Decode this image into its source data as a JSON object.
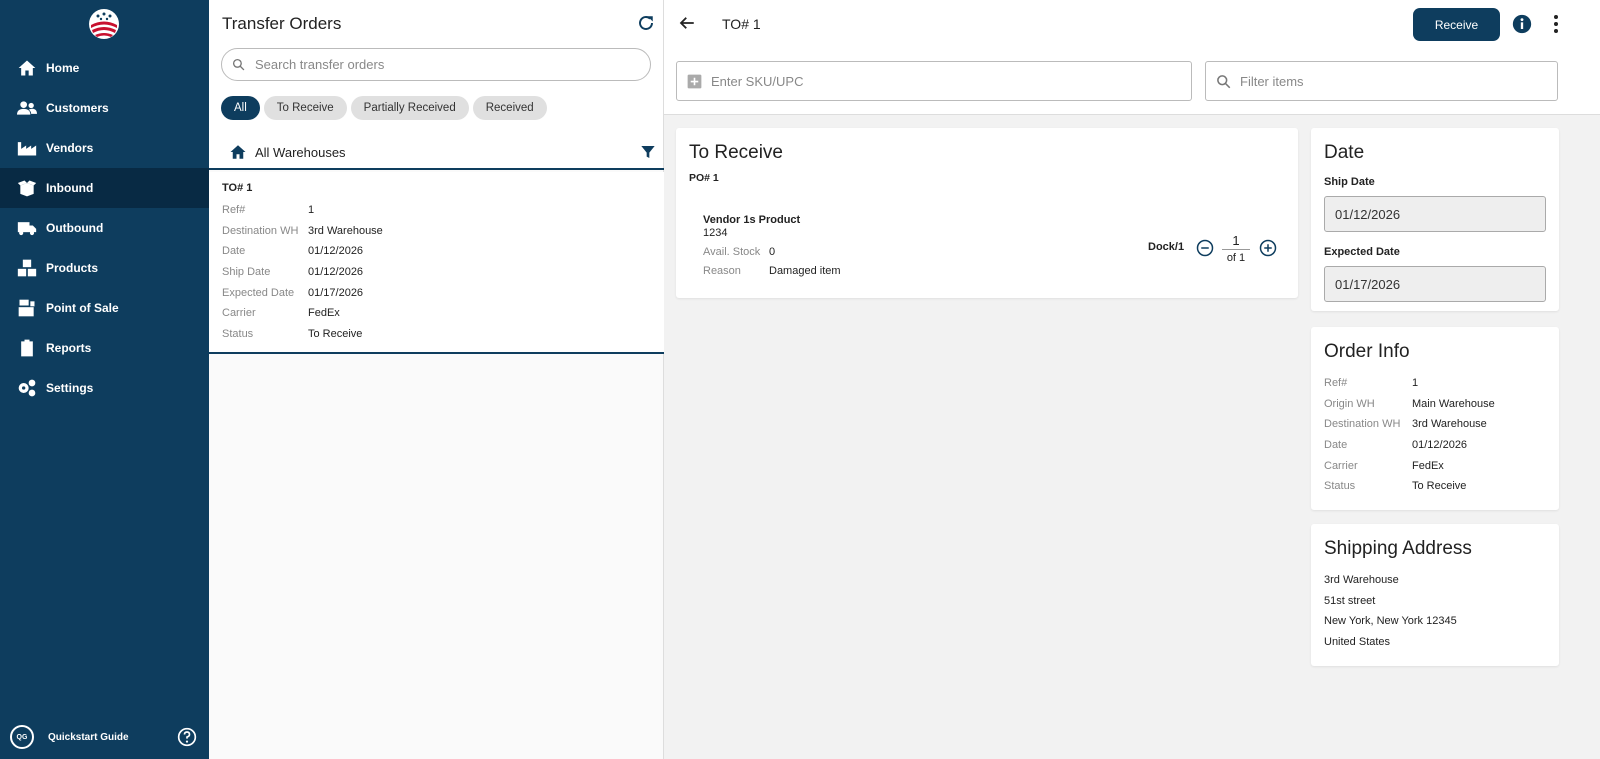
{
  "sidebar": {
    "items": [
      {
        "label": "Home",
        "icon": "home-icon"
      },
      {
        "label": "Customers",
        "icon": "users-icon"
      },
      {
        "label": "Vendors",
        "icon": "factory-icon"
      },
      {
        "label": "Inbound",
        "icon": "box-open-icon",
        "active": true
      },
      {
        "label": "Outbound",
        "icon": "truck-icon"
      },
      {
        "label": "Products",
        "icon": "boxes-icon"
      },
      {
        "label": "Point of Sale",
        "icon": "pos-icon"
      },
      {
        "label": "Reports",
        "icon": "clipboard-icon"
      },
      {
        "label": "Settings",
        "icon": "gears-icon"
      }
    ],
    "footer": {
      "badge": "QG",
      "label": "Quickstart Guide"
    }
  },
  "list": {
    "title": "Transfer Orders",
    "search_placeholder": "Search transfer orders",
    "chips": [
      "All",
      "To Receive",
      "Partially Received",
      "Received"
    ],
    "warehouse": "All Warehouses",
    "order": {
      "title": "TO# 1",
      "fields": [
        {
          "k": "Ref#",
          "v": "1"
        },
        {
          "k": "Destination WH",
          "v": "3rd Warehouse"
        },
        {
          "k": "Date",
          "v": "01/12/2026"
        },
        {
          "k": "Ship Date",
          "v": "01/12/2026"
        },
        {
          "k": "Expected Date",
          "v": "01/17/2026"
        },
        {
          "k": "Carrier",
          "v": "FedEx"
        },
        {
          "k": "Status",
          "v": "To Receive"
        }
      ]
    }
  },
  "main": {
    "title": "TO# 1",
    "receive_label": "Receive",
    "sku_placeholder": "Enter SKU/UPC",
    "filter_placeholder": "Filter items",
    "receive_card": {
      "title": "To Receive",
      "po": "PO# 1",
      "product": {
        "name": "Vendor 1s Product",
        "sku": "1234",
        "stock_label": "Avail. Stock",
        "stock_value": "0",
        "reason_label": "Reason",
        "reason_value": "Damaged item"
      },
      "dock": "Dock/1",
      "qty": "1",
      "of": "of 1"
    },
    "date_card": {
      "title": "Date",
      "ship_label": "Ship Date",
      "ship_value": "01/12/2026",
      "expected_label": "Expected Date",
      "expected_value": "01/17/2026"
    },
    "info_card": {
      "title": "Order Info",
      "fields": [
        {
          "k": "Ref#",
          "v": "1"
        },
        {
          "k": "Origin WH",
          "v": "Main Warehouse"
        },
        {
          "k": "Destination WH",
          "v": "3rd Warehouse"
        },
        {
          "k": "Date",
          "v": "01/12/2026"
        },
        {
          "k": "Carrier",
          "v": "FedEx"
        },
        {
          "k": "Status",
          "v": "To Receive"
        }
      ]
    },
    "address_card": {
      "title": "Shipping Address",
      "lines": [
        "3rd Warehouse",
        "51st street",
        "New York, New York 12345",
        "United States"
      ]
    }
  },
  "colors": {
    "primary": "#0e3d5e",
    "sidebar_active": "#082a44",
    "background": "#f2f2f2"
  }
}
